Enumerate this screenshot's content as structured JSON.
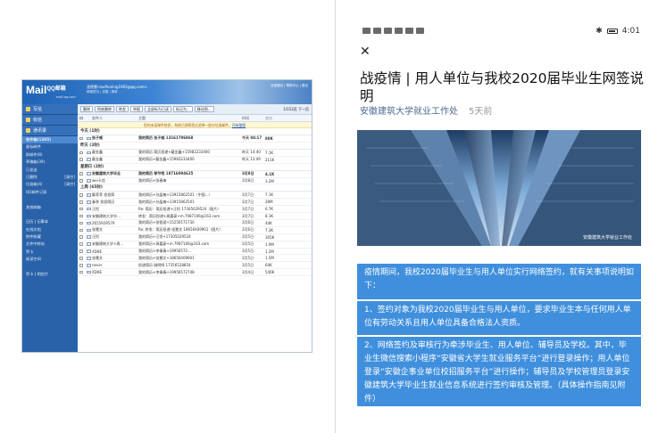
{
  "mail": {
    "logo": "Mail",
    "logo_cn": "QQ邮箱",
    "logo_sub": "mail.qq.com",
    "user": "凌德慧<buffonling1993@qq.com>",
    "user_links": "邮箱首页 | 设置 | 换肤",
    "top_links": "反馈建议 | 帮助中心 | 退出",
    "side_buttons": [
      "写信",
      "收信",
      "通讯录"
    ],
    "side_items": [
      {
        "label": "收件箱(1305)",
        "count": "",
        "active": true
      },
      {
        "label": "星标邮件",
        "count": ""
      },
      {
        "label": "群邮件(8)",
        "count": ""
      },
      {
        "label": "草稿箱(39)",
        "count": ""
      },
      {
        "label": "已发送",
        "count": ""
      },
      {
        "label": "已删除",
        "count": "[清空]"
      },
      {
        "label": "垃圾箱(4)",
        "count": "[清空]"
      },
      {
        "label": "QQ邮件订阅",
        "count": ""
      },
      {
        "label": "",
        "count": ""
      },
      {
        "label": "其他邮箱",
        "count": ""
      },
      {
        "label": "",
        "count": ""
      },
      {
        "label": "日历 | 记事本",
        "count": ""
      },
      {
        "label": "在线文档",
        "count": ""
      },
      {
        "label": "附件收藏",
        "count": ""
      },
      {
        "label": "文件中转站",
        "count": ""
      },
      {
        "label": "贺卡",
        "count": ""
      },
      {
        "label": "阅读空间",
        "count": ""
      },
      {
        "label": "",
        "count": ""
      },
      {
        "label": "贺卡 | 明信片",
        "count": ""
      }
    ],
    "toolbar": [
      "删除",
      "彻底删除",
      "转发",
      "举报",
      "全部标为已读",
      "标记为...",
      "移动到..."
    ],
    "pager": "1/153页 下一页",
    "columns": [
      "发件人",
      "主题",
      "时间",
      "大小"
    ],
    "notice": "您的未读邮件较多，系统已经帮您过滤掉一部分垃圾邮件，",
    "notice_link": "开始整理",
    "groups": [
      {
        "label": "今天 (1封)",
        "rows": [
          {
            "from": "张子威",
            "subject": "我的简历 张子威 13161706868",
            "time": "今天 04:17",
            "size": "80K",
            "unread": true
          }
        ]
      },
      {
        "label": "昨天 (2封)",
        "rows": [
          {
            "from": "戴金鑫",
            "subject": "我的简历 简历投递+戴金鑫+15983233400",
            "time": "昨天 14:40",
            "size": "7.1K",
            "unread": false
          },
          {
            "from": "戴金鑫",
            "subject": "我的简历+戴金鑫+15983233400",
            "time": "昨天 13:49",
            "size": "211K",
            "unread": false
          }
        ]
      },
      {
        "label": "星期日 (2封)",
        "rows": [
          {
            "from": "安徽建筑大学毕业",
            "subject": "我的简历 季节悦 18716004625",
            "time": "3月8日",
            "size": "4.1K",
            "unread": true
          },
          {
            "from": "wei卡信",
            "subject": "我的简历+张春梅",
            "time": "3月8日",
            "size": "3.2M",
            "unread": false
          }
        ]
      },
      {
        "label": "上周 (65封)",
        "rows": [
          {
            "from": "戴菲菲 投投简",
            "subject": "我的简历+孙晶楠+13915862501（中国...）",
            "time": "3月7日",
            "size": "7.1K",
            "unread": false
          },
          {
            "from": "春季 投投简历",
            "subject": "我的简历+孙晶楠+13915862501",
            "time": "3月7日",
            "size": "28M",
            "unread": false
          },
          {
            "from": "汪恒",
            "subject": "Re: 简历：简历投递+汪恒 17305029524（图片）",
            "time": "3月7日",
            "size": "6.7K",
            "unread": false
          },
          {
            "from": "安徽建筑大学毕...",
            "subject": "转发：简历投递+周嘉豪+m.7987106@163.com",
            "time": "3月7日",
            "size": "8.1K",
            "unread": false
          },
          {
            "from": "2655929579",
            "subject": "我的简历+张智斌+15256571730",
            "time": "3月6日",
            "size": "44K",
            "unread": false
          },
          {
            "from": "张慧文",
            "subject": "Re: 转发：简历投递-张慧文 18656409901（图片）",
            "time": "3月6日",
            "size": "7.3K",
            "unread": false
          },
          {
            "from": "汪恒",
            "subject": "我的简历+汪恒+17305029524",
            "time": "3月5日",
            "size": "305K",
            "unread": false
          },
          {
            "from": "安徽建筑大学+周...",
            "subject": "我的简历+周嘉豪+m.7987106@163.com",
            "time": "3月5日",
            "size": "1.9M",
            "unread": false
          },
          {
            "from": "XDKE",
            "subject": "我的简历+李倩倩+19956572...",
            "time": "3月5日",
            "size": "1.2M",
            "unread": false
          },
          {
            "from": "张慧文",
            "subject": "我的简历+张慧文+18656409901",
            "time": "3月5日",
            "size": "1.5M",
            "unread": false
          },
          {
            "from": "never",
            "subject": "投递简历 姚明明 17356528854",
            "time": "3月5日",
            "size": "64K",
            "unread": false
          },
          {
            "from": "XDKE",
            "subject": "我的简历+李倩倩+19956572748",
            "time": "3月4日",
            "size": "546K",
            "unread": false
          }
        ]
      }
    ]
  },
  "phone": {
    "status_time": "4:01",
    "title": "战疫情 | 用人单位与我校2020届毕业生网签说明",
    "source": "安徽建筑大学就业工作处",
    "time_ago": "5天前",
    "watermark": "安徽建筑大学就业工作处",
    "paragraph1": "疫情期间，我校2020届毕业生与用人单位实行网络签约，就有关事项说明如下：",
    "paragraph2": "1、签约对象为我校2020届毕业生与用人单位，要求毕业生本与任何用人单位有劳动关系且用人单位具备合格法人资质。",
    "paragraph3": "2、网络签约及审核行为牵涉毕业生、用人单位、辅导员及学校。其中，毕业生微信搜索小程序“安徽省大学生就业服务平台”进行登录操作；用人单位登录“安徽企事业单位校招服务平台”进行操作；辅导员及学校管理员登录安徽建筑大学毕业生就业信息系统进行签约审核及管理。（具体操作指南见附件）"
  }
}
